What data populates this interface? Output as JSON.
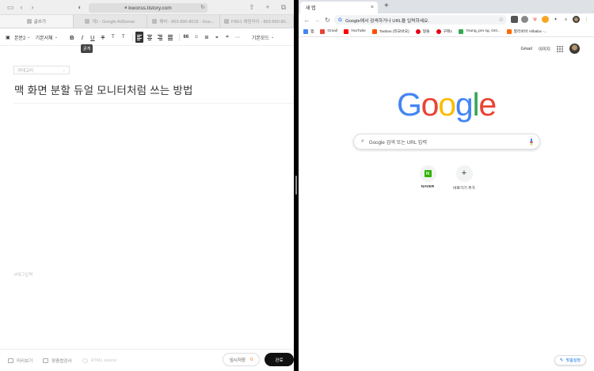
{
  "safari": {
    "url": "kwonss.tistory.com",
    "tabs": [
      {
        "label": "글쓰기",
        "active": true
      },
      {
        "label": "게2 - Google AdSense",
        "active": false
      },
      {
        "label": "꿰바 - 863-890-8019 - Goo...",
        "active": false
      },
      {
        "label": "FBE1 애덴라이 - 863-890-80...",
        "active": false
      }
    ]
  },
  "editor": {
    "toolbar": {
      "image_label": "▣",
      "paragraph_label": "본문2",
      "font_label": "기본서체",
      "bold": "B",
      "italic": "I",
      "underline": "U",
      "strike": "T",
      "color": "T",
      "bg": "T",
      "quote": "66",
      "more": "기본모드",
      "tooltip": "굵게"
    },
    "category_placeholder": "카테고리",
    "title": "맥 화면 분할 듀얼 모니터처럼 쓰는 방법",
    "tag_placeholder": "#태그입력",
    "footer": {
      "preview": "미리보기",
      "spellcheck": "맞춤법검사",
      "source": "HTML source",
      "temp_save": "임시저장",
      "temp_count": "0",
      "publish": "완료"
    }
  },
  "chrome": {
    "tab_title": "새 탭",
    "omnibox_placeholder": "Google에서 검색하거나 URL을 입력하세요.",
    "bookmarks": [
      {
        "label": "앱",
        "color": "#4285f4"
      },
      {
        "label": "Gmail",
        "color": "#ea4335"
      },
      {
        "label": "YouTube",
        "color": "#ff0000"
      },
      {
        "label": "Taobao (타오바오)",
        "color": "#ff5000"
      },
      {
        "label": "알뜰",
        "color": "#e60012"
      },
      {
        "label": "구매1",
        "color": "#e60012"
      },
      {
        "label": "Young_pro sg, Onl...",
        "color": "#34a853"
      },
      {
        "label": "알리바바 Alibaba -...",
        "color": "#ff6a00"
      }
    ],
    "gmail": "Gmail",
    "images": "이미지",
    "search_placeholder": "Google 검색 또는 URL 입력",
    "logo": [
      "G",
      "o",
      "o",
      "g",
      "l",
      "e"
    ],
    "logo_colors": [
      "#4285f4",
      "#ea4335",
      "#fbbc05",
      "#4285f4",
      "#34a853",
      "#ea4335"
    ],
    "shortcuts": [
      {
        "label": "NAVER"
      },
      {
        "label": "바로가기 추가"
      }
    ],
    "customize": "맞춤설정"
  }
}
